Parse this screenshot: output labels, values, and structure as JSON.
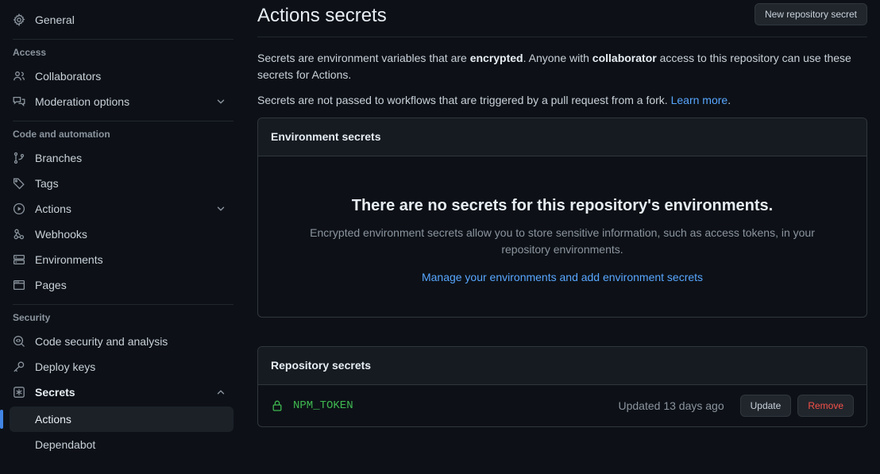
{
  "sidebar": {
    "top_items": [
      {
        "label": "General",
        "icon": "gear-icon",
        "name": "general",
        "chevron": "",
        "bold": false
      }
    ],
    "sections": [
      {
        "heading": "Access",
        "items": [
          {
            "label": "Collaborators",
            "icon": "people-icon",
            "name": "collaborators",
            "chevron": "",
            "bold": false
          },
          {
            "label": "Moderation options",
            "icon": "comment-discussion-icon",
            "name": "moderation-options",
            "chevron": "down",
            "bold": false
          }
        ]
      },
      {
        "heading": "Code and automation",
        "items": [
          {
            "label": "Branches",
            "icon": "git-branch-icon",
            "name": "branches",
            "chevron": "",
            "bold": false
          },
          {
            "label": "Tags",
            "icon": "tag-icon",
            "name": "tags",
            "chevron": "",
            "bold": false
          },
          {
            "label": "Actions",
            "icon": "play-circle-icon",
            "name": "actions",
            "chevron": "down",
            "bold": false
          },
          {
            "label": "Webhooks",
            "icon": "webhook-icon",
            "name": "webhooks",
            "chevron": "",
            "bold": false
          },
          {
            "label": "Environments",
            "icon": "server-icon",
            "name": "environments",
            "chevron": "",
            "bold": false
          },
          {
            "label": "Pages",
            "icon": "browser-icon",
            "name": "pages",
            "chevron": "",
            "bold": false
          }
        ]
      },
      {
        "heading": "Security",
        "items": [
          {
            "label": "Code security and analysis",
            "icon": "codescan-icon",
            "name": "code-security-and-analysis",
            "chevron": "",
            "bold": false
          },
          {
            "label": "Deploy keys",
            "icon": "key-icon",
            "name": "deploy-keys",
            "chevron": "",
            "bold": false
          },
          {
            "label": "Secrets",
            "icon": "asterisk-box-icon",
            "name": "secrets",
            "chevron": "up",
            "bold": true
          }
        ]
      }
    ],
    "secrets_subitems": [
      {
        "label": "Actions",
        "name": "secrets-actions",
        "selected": true
      },
      {
        "label": "Dependabot",
        "name": "secrets-dependabot",
        "selected": false
      }
    ]
  },
  "header": {
    "title": "Actions secrets",
    "new_secret_button": "New repository secret"
  },
  "description": {
    "p1_part1": "Secrets are environment variables that are ",
    "p1_bold1": "encrypted",
    "p1_part2": ". Anyone with ",
    "p1_bold2": "collaborator",
    "p1_part3": " access to this repository can use these secrets for Actions.",
    "p2_text": "Secrets are not passed to workflows that are triggered by a pull request from a fork. ",
    "p2_link": "Learn more",
    "p2_period": "."
  },
  "environment_secrets": {
    "card_title": "Environment secrets",
    "empty_heading": "There are no secrets for this repository's environments.",
    "empty_body": "Encrypted environment secrets allow you to store sensitive information, such as access tokens, in your repository environments.",
    "manage_link": "Manage your environments and add environment secrets"
  },
  "repository_secrets": {
    "card_title": "Repository secrets",
    "rows": [
      {
        "icon": "lock-icon",
        "name": "NPM_TOKEN",
        "updated": "Updated 13 days ago",
        "update_label": "Update",
        "remove_label": "Remove"
      }
    ]
  },
  "colors": {
    "page_bg": "#0d1117",
    "card_header_bg": "#161b22",
    "border": "#30363d",
    "accent_blue": "#58a6ff",
    "selected_bar": "#4184e4",
    "green": "#3fb950",
    "danger_red": "#f85149",
    "muted": "#8b949e"
  }
}
